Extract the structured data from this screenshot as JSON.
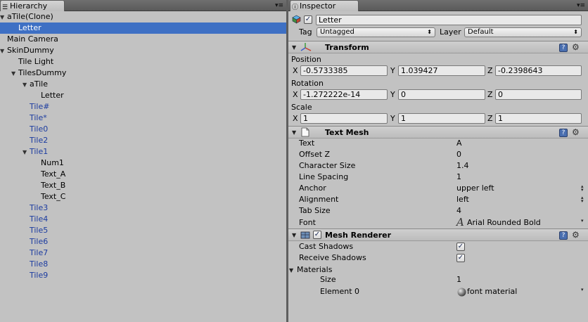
{
  "hierarchy": {
    "tab_label": "Hierarchy",
    "rows": [
      {
        "label": "aTile(Clone)",
        "indent": 0,
        "tri": "down",
        "prefab": false,
        "selected": false
      },
      {
        "label": "Letter",
        "indent": 1,
        "tri": "",
        "prefab": false,
        "selected": true
      },
      {
        "label": "Main Camera",
        "indent": 0,
        "tri": "",
        "prefab": false,
        "selected": false
      },
      {
        "label": "SkinDummy",
        "indent": 0,
        "tri": "down",
        "prefab": false,
        "selected": false
      },
      {
        "label": "Tile Light",
        "indent": 1,
        "tri": "",
        "prefab": false,
        "selected": false
      },
      {
        "label": "TilesDummy",
        "indent": 1,
        "tri": "down",
        "prefab": false,
        "selected": false
      },
      {
        "label": "aTile",
        "indent": 2,
        "tri": "down",
        "prefab": false,
        "selected": false
      },
      {
        "label": "Letter",
        "indent": 3,
        "tri": "",
        "prefab": false,
        "selected": false
      },
      {
        "label": "Tile#",
        "indent": 2,
        "tri": "",
        "prefab": true,
        "selected": false
      },
      {
        "label": "Tile*",
        "indent": 2,
        "tri": "",
        "prefab": true,
        "selected": false
      },
      {
        "label": "Tile0",
        "indent": 2,
        "tri": "",
        "prefab": true,
        "selected": false
      },
      {
        "label": "Tile2",
        "indent": 2,
        "tri": "",
        "prefab": true,
        "selected": false
      },
      {
        "label": "Tile1",
        "indent": 2,
        "tri": "down",
        "prefab": true,
        "selected": false
      },
      {
        "label": "Num1",
        "indent": 3,
        "tri": "",
        "prefab": false,
        "selected": false
      },
      {
        "label": "Text_A",
        "indent": 3,
        "tri": "",
        "prefab": false,
        "selected": false
      },
      {
        "label": "Text_B",
        "indent": 3,
        "tri": "",
        "prefab": false,
        "selected": false
      },
      {
        "label": "Text_C",
        "indent": 3,
        "tri": "",
        "prefab": false,
        "selected": false
      },
      {
        "label": "Tile3",
        "indent": 2,
        "tri": "",
        "prefab": true,
        "selected": false
      },
      {
        "label": "Tile4",
        "indent": 2,
        "tri": "",
        "prefab": true,
        "selected": false
      },
      {
        "label": "Tile5",
        "indent": 2,
        "tri": "",
        "prefab": true,
        "selected": false
      },
      {
        "label": "Tile6",
        "indent": 2,
        "tri": "",
        "prefab": true,
        "selected": false
      },
      {
        "label": "Tile7",
        "indent": 2,
        "tri": "",
        "prefab": true,
        "selected": false
      },
      {
        "label": "Tile8",
        "indent": 2,
        "tri": "",
        "prefab": true,
        "selected": false
      },
      {
        "label": "Tile9",
        "indent": 2,
        "tri": "",
        "prefab": true,
        "selected": false
      }
    ]
  },
  "inspector": {
    "tab_label": "Inspector",
    "object_name": "Letter",
    "active": true,
    "tag_label": "Tag",
    "tag_value": "Untagged",
    "layer_label": "Layer",
    "layer_value": "Default",
    "transform": {
      "title": "Transform",
      "position_label": "Position",
      "rotation_label": "Rotation",
      "scale_label": "Scale",
      "axis_x": "X",
      "axis_y": "Y",
      "axis_z": "Z",
      "position": {
        "x": "-0.5733385",
        "y": "1.039427",
        "z": "-0.2398643"
      },
      "rotation": {
        "x": "-1.272222e-14",
        "y": "0",
        "z": "0"
      },
      "scale": {
        "x": "1",
        "y": "1",
        "z": "1"
      }
    },
    "text_mesh": {
      "title": "Text Mesh",
      "props": [
        {
          "label": "Text",
          "value": "A"
        },
        {
          "label": "Offset Z",
          "value": "0"
        },
        {
          "label": "Character Size",
          "value": "1.4"
        },
        {
          "label": "Line Spacing",
          "value": "1"
        },
        {
          "label": "Anchor",
          "value": "upper left"
        },
        {
          "label": "Alignment",
          "value": "left"
        },
        {
          "label": "Tab Size",
          "value": "4"
        }
      ],
      "font_label": "Font",
      "font_value": "Arial Rounded Bold"
    },
    "mesh_renderer": {
      "title": "Mesh Renderer",
      "enabled": true,
      "cast_shadows_label": "Cast Shadows",
      "cast_shadows": true,
      "receive_shadows_label": "Receive Shadows",
      "receive_shadows": true,
      "materials_label": "Materials",
      "size_label": "Size",
      "size_value": "1",
      "element0_label": "Element 0",
      "element0_value": "font material"
    }
  },
  "colors": {
    "selection": "#3e70c4",
    "prefab_text": "#1c3ca0",
    "panel_bg": "#c2c2c2"
  },
  "icons": {
    "hierarchy_tab": "hierarchy-list-icon",
    "inspector_tab": "info-icon",
    "object": "gameobject-cube-icon",
    "transform": "transform-axes-icon",
    "text_mesh": "document-icon",
    "mesh_renderer": "mesh-renderer-icon",
    "help": "help-book-icon",
    "gear": "gear-icon",
    "font": "font-glyph-icon",
    "material": "material-sphere-icon"
  }
}
